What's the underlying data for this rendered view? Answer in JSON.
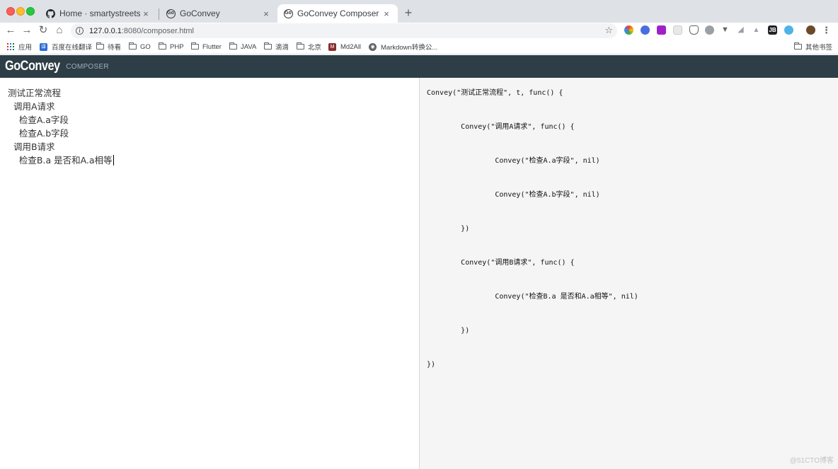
{
  "browser": {
    "tabs": [
      {
        "title": "Home · smartystreets/goconvey",
        "icon": "github-icon",
        "active": false
      },
      {
        "title": "GoConvey",
        "icon": "goconvey-icon",
        "active": false
      },
      {
        "title": "GoConvey Composer",
        "icon": "goconvey-icon",
        "active": true
      }
    ],
    "tab_close_glyph": "×",
    "new_tab_glyph": "+",
    "url_host": "127.0.0.1",
    "url_rest": ":8080/composer.html",
    "bookmarks": [
      {
        "label": "应用",
        "icon": "apps-grid-icon"
      },
      {
        "label": "百度在线翻译",
        "icon": "translate-icon"
      },
      {
        "label": "待看",
        "icon": "folder-icon"
      },
      {
        "label": "GO",
        "icon": "folder-icon"
      },
      {
        "label": "PHP",
        "icon": "folder-icon"
      },
      {
        "label": "Flutter",
        "icon": "folder-icon"
      },
      {
        "label": "JAVA",
        "icon": "folder-icon"
      },
      {
        "label": "滴滴",
        "icon": "folder-icon"
      },
      {
        "label": "北京",
        "icon": "folder-icon"
      },
      {
        "label": "Md2All",
        "icon": "md2all-icon"
      },
      {
        "label": "Markdown转换公...",
        "icon": "globe-icon"
      }
    ],
    "other_bookmarks": "其他书签"
  },
  "app": {
    "logo": "GoConvey",
    "subtitle": "COMPOSER"
  },
  "editor": {
    "text": "测试正常流程\n\t调用A请求\n\t\t检查A.a字段\n\t\t检查A.b字段\n\t调用B请求\n\t\t检查B.a 是否和A.a相等"
  },
  "output": {
    "code": "Convey(\"测试正常流程\", t, func() {\n\n\tConvey(\"调用A请求\", func() {\n\n\t\tConvey(\"检查A.a字段\", nil)\n\n\t\tConvey(\"检查A.b字段\", nil)\n\n\t})\n\n\tConvey(\"调用B请求\", func() {\n\n\t\tConvey(\"检查B.a 是否和A.a相等\", nil)\n\n\t})\n\n})"
  },
  "watermark": "@51CTO博客"
}
